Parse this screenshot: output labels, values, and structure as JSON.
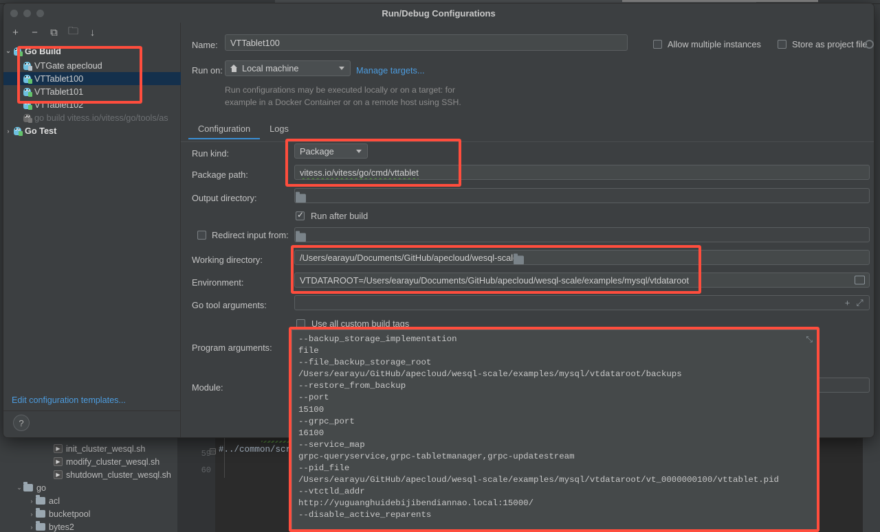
{
  "window": {
    "title": "Run/Debug Configurations"
  },
  "sidebar": {
    "toolbar": [
      {
        "name": "add-configuration-button",
        "glyph": "+"
      },
      {
        "name": "remove-configuration-button",
        "glyph": "−"
      },
      {
        "name": "copy-configuration-button",
        "glyph": "⧉"
      },
      {
        "name": "new-folder-button",
        "glyph": "🗀"
      },
      {
        "name": "sort-alphabetically-button",
        "glyph": "↓"
      }
    ],
    "groups": [
      {
        "label": "Go Build",
        "expanded": true,
        "caret": "⌄"
      },
      {
        "label": "Go Test",
        "expanded": false,
        "caret": "›"
      }
    ],
    "items": [
      {
        "label": "VTGate apecloud",
        "selected": false,
        "dim": false
      },
      {
        "label": "VTTablet100",
        "selected": true,
        "dim": false
      },
      {
        "label": "VTTablet101",
        "selected": false,
        "dim": false
      },
      {
        "label": "VTTablet102",
        "selected": false,
        "dim": false
      },
      {
        "label": "go build vitess.io/vitess/go/tools/as",
        "selected": false,
        "dim": true
      }
    ],
    "edit_templates_link": "Edit configuration templates...",
    "help_glyph": "?"
  },
  "form": {
    "name_label": "Name:",
    "name_value": "VTTablet100",
    "run_on_label": "Run on:",
    "run_on_value": "Local machine",
    "manage_targets_link": "Manage targets...",
    "hint_line1": "Run configurations may be executed locally or on a target: for",
    "hint_line2": "example in a Docker Container or on a remote host using SSH.",
    "allow_multiple_instances": "Allow multiple instances",
    "store_as_project_file": "Store as project file",
    "tabs": [
      {
        "label": "Configuration",
        "active": true
      },
      {
        "label": "Logs",
        "active": false
      }
    ],
    "run_kind_label": "Run kind:",
    "run_kind_value": "Package",
    "package_path_label": "Package path:",
    "package_path_value": "vitess.io/vitess/go/cmd/vttablet",
    "output_directory_label": "Output directory:",
    "output_directory_value": "",
    "run_after_build_label": "Run after build",
    "run_after_build_checked": true,
    "redirect_input_label": "Redirect input from:",
    "redirect_input_value": "",
    "redirect_input_checked": false,
    "working_directory_label": "Working directory:",
    "working_directory_value": "/Users/earayu/Documents/GitHub/apecloud/wesql-scale",
    "environment_label": "Environment:",
    "environment_value": "VTDATAROOT=/Users/earayu/Documents/GitHub/apecloud/wesql-scale/examples/mysql/vtdataroot",
    "go_tool_arguments_label": "Go tool arguments:",
    "go_tool_arguments_value": "",
    "use_all_custom_build_tags_label": "Use all custom build tags",
    "use_all_custom_build_tags_checked": false,
    "program_arguments_label": "Program arguments:",
    "program_arguments_value": "--backup_storage_implementation\nfile\n--file_backup_storage_root\n/Users/earayu/GitHub/apecloud/wesql-scale/examples/mysql/vtdataroot/backups\n--restore_from_backup\n--port\n15100\n--grpc_port\n16100\n--service_map\ngrpc-queryservice,grpc-tabletmanager,grpc-updatestream\n--pid_file\n/Users/earayu/GitHub/apecloud/wesql-scale/examples/mysql/vtdataroot/vt_0000000100/vttablet.pid\n--vtctld_addr\nhttp://yuguanghuidebijibendiannao.local:15000/\n--disable_active_reparents",
    "module_label": "Module:",
    "module_value": ""
  },
  "ide_background": {
    "project_files": [
      {
        "label": "init_cluster_wesql.sh",
        "type": "script",
        "indent": 2
      },
      {
        "label": "modify_cluster_wesql.sh",
        "type": "script",
        "indent": 2
      },
      {
        "label": "shutdown_cluster_wesql.sh",
        "type": "script",
        "indent": 2
      },
      {
        "label": "go",
        "type": "folder",
        "indent": 1,
        "caret": "⌄"
      },
      {
        "label": "acl",
        "type": "folder",
        "indent": 2,
        "caret": "›"
      },
      {
        "label": "bucketpool",
        "type": "folder",
        "indent": 2,
        "caret": "›"
      },
      {
        "label": "bytes2",
        "type": "folder",
        "indent": 2,
        "caret": "›"
      }
    ],
    "editor_lines": [
      {
        "number": "59",
        "text": "#../common/scr"
      },
      {
        "number": "60",
        "text": ""
      }
    ]
  },
  "colors": {
    "annotation": "#ff4d3d",
    "accent": "#3a8fd6",
    "link": "#4d9de0",
    "selection": "#14304c",
    "dialog_bg": "#3c3f41"
  }
}
